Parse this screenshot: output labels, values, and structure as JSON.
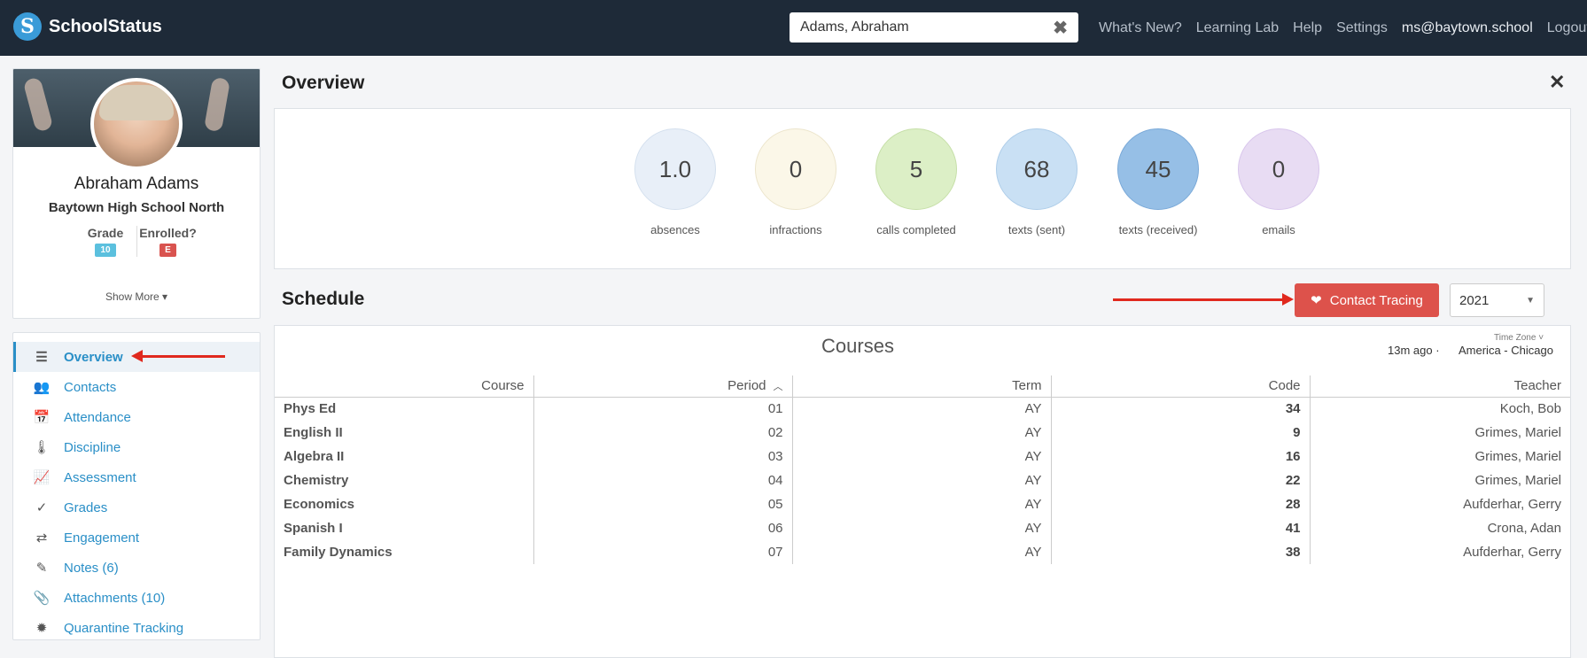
{
  "app": {
    "name": "SchoolStatus",
    "logo_letter": "S"
  },
  "search": {
    "value": "Adams, Abraham",
    "clear_icon": "close-icon"
  },
  "nav": [
    "What's New?",
    "Learning Lab",
    "Help",
    "Settings",
    "ms@baytown.school",
    "Logout"
  ],
  "student": {
    "name": "Abraham Adams",
    "school": "Baytown High School North",
    "grade_label": "Grade",
    "grade_value": "10",
    "enrolled_label": "Enrolled?",
    "enrolled_value": "E",
    "show_more": "Show More ▾"
  },
  "sidebar": {
    "items": [
      {
        "label": "Overview",
        "icon": "list-icon",
        "glyph": "☰",
        "active": true
      },
      {
        "label": "Contacts",
        "icon": "users-icon",
        "glyph": "👥"
      },
      {
        "label": "Attendance",
        "icon": "calendar-icon",
        "glyph": "📅"
      },
      {
        "label": "Discipline",
        "icon": "thermometer-icon",
        "glyph": "🌡"
      },
      {
        "label": "Assessment",
        "icon": "chart-icon",
        "glyph": "📈"
      },
      {
        "label": "Grades",
        "icon": "check-icon",
        "glyph": "✓"
      },
      {
        "label": "Engagement",
        "icon": "exchange-icon",
        "glyph": "⇄"
      },
      {
        "label": "Notes (6)",
        "icon": "pencil-icon",
        "glyph": "✎"
      },
      {
        "label": "Attachments (10)",
        "icon": "paperclip-icon",
        "glyph": "📎"
      },
      {
        "label": "Quarantine Tracking",
        "icon": "virus-icon",
        "glyph": "✹"
      }
    ]
  },
  "overview": {
    "title": "Overview",
    "stats": [
      {
        "value": "1.0",
        "label": "absences",
        "color": "#e8eff8",
        "border": "#d4e0ee"
      },
      {
        "value": "0",
        "label": "infractions",
        "color": "#fbf7e8",
        "border": "#ece5cc"
      },
      {
        "value": "5",
        "label": "calls completed",
        "color": "#dcefc6",
        "border": "#c6dfa8"
      },
      {
        "value": "68",
        "label": "texts (sent)",
        "color": "#c9e0f4",
        "border": "#aecde9"
      },
      {
        "value": "45",
        "label": "texts (received)",
        "color": "#96bfe6",
        "border": "#7aa9d8"
      },
      {
        "value": "0",
        "label": "emails",
        "color": "#e8dcf3",
        "border": "#d8c6ec"
      }
    ]
  },
  "schedule": {
    "title": "Schedule",
    "contact_tracing_label": "Contact Tracing",
    "year": "2021",
    "courses_title": "Courses",
    "time_zone_label": "Time Zone ˅",
    "updated": "13m ago  ·",
    "time_zone_value": "America - Chicago",
    "columns": [
      "Course",
      "Period",
      "Term",
      "Code",
      "Teacher"
    ],
    "rows": [
      [
        "Phys Ed",
        "01",
        "AY",
        "34",
        "Koch, Bob"
      ],
      [
        "English II",
        "02",
        "AY",
        "9",
        "Grimes, Mariel"
      ],
      [
        "Algebra II",
        "03",
        "AY",
        "16",
        "Grimes, Mariel"
      ],
      [
        "Chemistry",
        "04",
        "AY",
        "22",
        "Grimes, Mariel"
      ],
      [
        "Economics",
        "05",
        "AY",
        "28",
        "Aufderhar, Gerry"
      ],
      [
        "Spanish I",
        "06",
        "AY",
        "41",
        "Crona, Adan"
      ],
      [
        "Family Dynamics",
        "07",
        "AY",
        "38",
        "Aufderhar, Gerry"
      ]
    ]
  },
  "colors": {
    "accent": "#2a8fc7",
    "topbar": "#1e2a38",
    "contact_tracing": "#dd524b",
    "annotation_arrow": "#e0291e"
  }
}
